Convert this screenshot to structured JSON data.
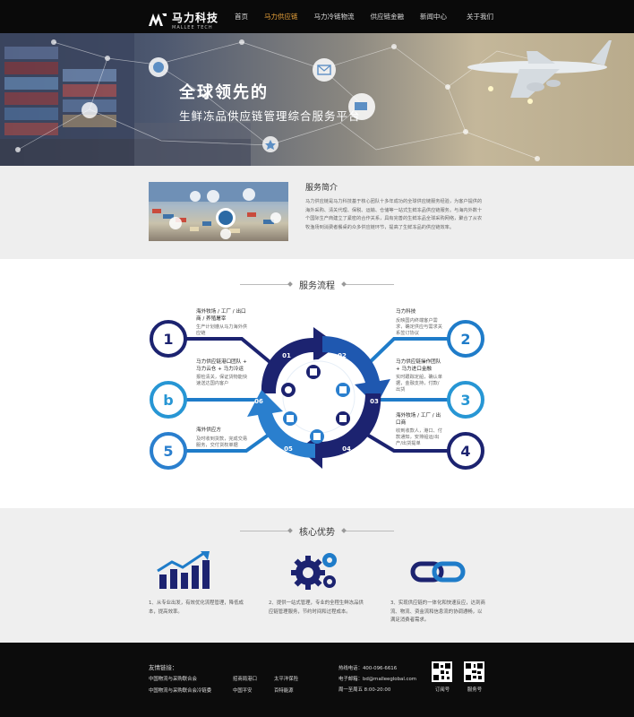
{
  "header": {
    "logo_text": "马力科技",
    "logo_sub": "MALLEE TECH",
    "nav": [
      {
        "label": "首页",
        "active": false
      },
      {
        "label": "马力供应链",
        "active": true
      },
      {
        "label": "马力冷链物流",
        "active": false
      },
      {
        "label": "供应链金融",
        "active": false
      },
      {
        "label": "新闻中心",
        "active": false
      },
      {
        "label": "关于我们",
        "active": false
      }
    ]
  },
  "hero": {
    "title": "全球领先的",
    "subtitle": "生鲜冻品供应链管理综合服务平台"
  },
  "intro": {
    "title": "服务简介",
    "body": "马力供应链是马力科技基于核心团队十多年成功的全球供应链服务经验，为客户提供的海外采购、清关代理、保税、运输、仓储等一站式生鲜冻品供应链服务。与海内外数十个国际生产商建立了紧密的合作关系，具有完善的生鲜冻品全球采购网络，聚合了从农牧渔场到消费者餐桌的众多供应链环节，提高了生鲜冻品的供应链效率。"
  },
  "process": {
    "title": "服务流程",
    "segments": [
      "01",
      "02",
      "03",
      "04",
      "05",
      "06"
    ],
    "steps": [
      {
        "num": "1",
        "title": "海外牧场 / 工厂 / 出口商 / 养殖屠宰",
        "desc": "生产计划遵从马力海外供应链"
      },
      {
        "num": "2",
        "title": "马力科技",
        "desc": "反映国内终端客户需求，确定供应与需求关系签订协议"
      },
      {
        "num": "3",
        "title": "马力供应链操作团队 + 马力进口金融",
        "desc": "实时跟踪定船，确认单据，金融支持，付款/出货"
      },
      {
        "num": "4",
        "title": "海外牧场 / 工厂 / 出口商",
        "desc": "收到收款人，港口、付款通知，安排船运/出产/出货提单"
      },
      {
        "num": "5",
        "title": "海外供应方",
        "desc": "及时收到货款，完成交易服务，交付货权单据"
      },
      {
        "num": "b",
        "title": "马力供应链港口团队 + 马力云仓 + 马力冷运",
        "desc": "报检清关，保证货物能快速送达国内客户"
      }
    ]
  },
  "advantages": {
    "title": "核心优势",
    "items": [
      {
        "icon": "chart-icon",
        "text": "1、从专业出发，有效优化流程管理，降低成本，提高效率。"
      },
      {
        "icon": "gears-icon",
        "text": "2、提供一站式管理，专业的全程生鲜冻品供应链管理服务，节约时间和过程成本。"
      },
      {
        "icon": "chain-icon",
        "text": "3、实现供应链的一体化和快速反应，达到商流、物流、资金流和信息流的协调通畅，以满足消费者需求。"
      }
    ]
  },
  "footer": {
    "links_label": "友情链接：",
    "links": [
      "中国物流与采购联合会",
      "招商局港口",
      "太平洋保险",
      "中国物流与采购联合会冷链委",
      "中国平安",
      "百特能源"
    ],
    "phone": "热线电话：400-096-6616",
    "email": "电子邮箱：bd@malleeglobal.com",
    "hours": "周一至周五 8:00-20:00",
    "qr": [
      {
        "caption": "订阅号"
      },
      {
        "caption": "服务号"
      }
    ]
  },
  "colors": {
    "topbar": "#0a0a0a",
    "accent": "#e9a33b",
    "navy": "#1c2370",
    "blue": "#1f7cc9",
    "light_blue": "#3aa6e0"
  }
}
